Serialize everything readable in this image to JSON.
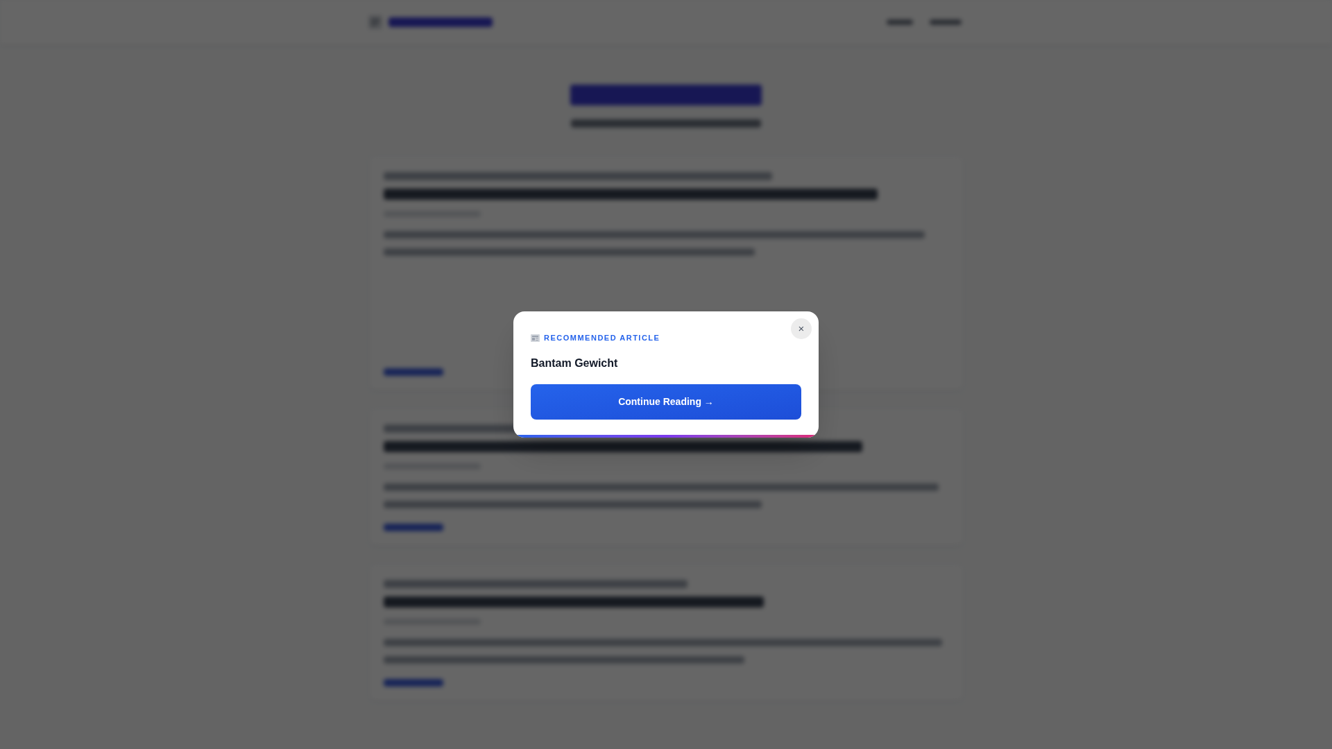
{
  "modal": {
    "label": "RECOMMENDED ARTICLE",
    "title": "Bantam Gewicht",
    "button": "Continue Reading →",
    "close": "×"
  }
}
